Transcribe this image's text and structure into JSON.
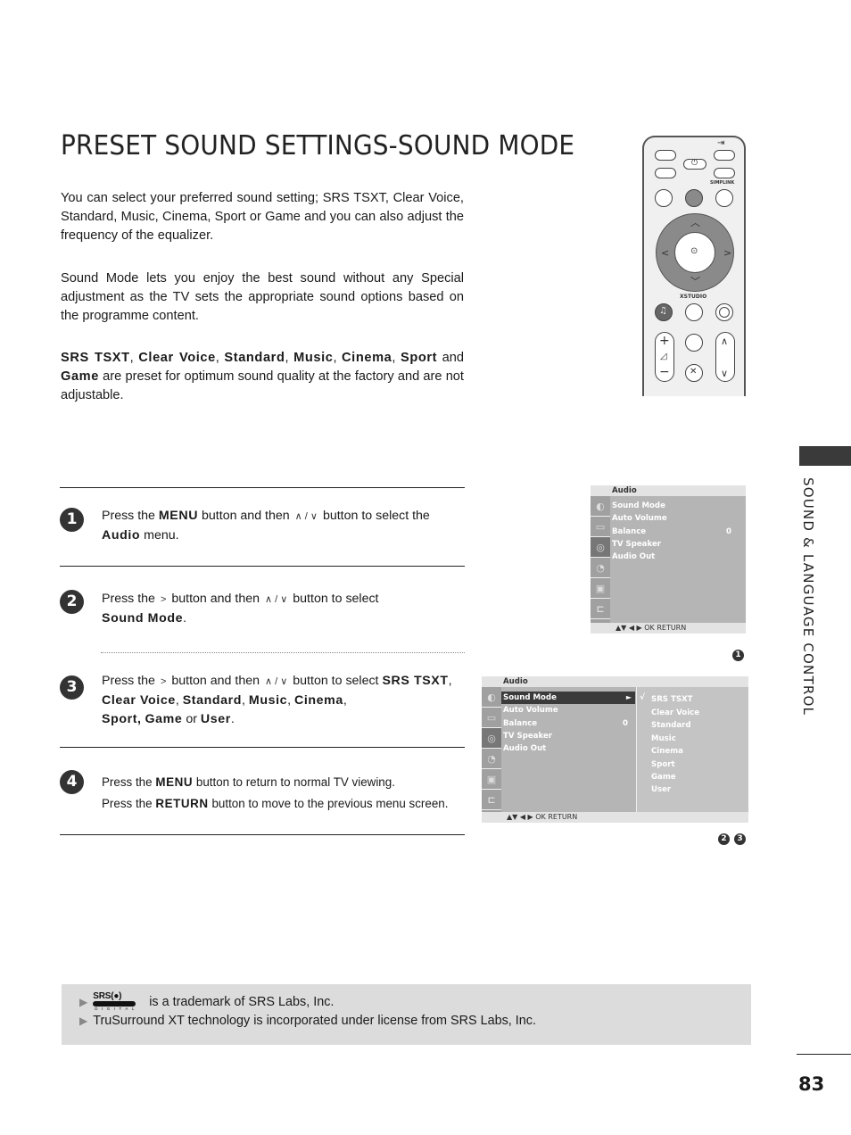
{
  "title": "PRESET SOUND SETTINGS-SOUND MODE",
  "intro": {
    "p1": "You can select your preferred sound setting; SRS TSXT, Clear Voice, Standard, Music, Cinema, Sport or Game and you can also adjust the  frequency of the equalizer.",
    "p2": "Sound Mode lets you enjoy the best sound without any Special adjustment as the TV sets the appropriate sound options based on the programme content.",
    "p3": {
      "bold_items": [
        "SRS TSXT",
        "Clear Voice",
        "Standard",
        "Music",
        "Cinema",
        "Sport"
      ],
      "and_label": "and",
      "game": "Game",
      "rest": "are preset for optimum sound quality at the factory and are not adjustable."
    }
  },
  "remote": {
    "labels": {
      "simplink": "SIMPLINK",
      "xstudio": "XSTUDIO"
    },
    "icons": [
      "input-icon",
      "power-icon",
      "up-arrow-icon",
      "down-arrow-icon",
      "left-arrow-icon",
      "right-arrow-icon",
      "ok-icon",
      "headphone-icon",
      "volume-plus-icon",
      "volume-minus-icon",
      "mute-icon",
      "channel-up-icon",
      "channel-down-icon"
    ]
  },
  "side_tab": {
    "label": "SOUND & LANGUAGE CONTROL"
  },
  "steps": [
    {
      "number": "1",
      "parts": {
        "a": "Press the",
        "menu": "MENU",
        "b": "button and then",
        "c": "button to select the",
        "audio": "Audio",
        "d": "menu."
      }
    },
    {
      "number": "2",
      "parts": {
        "a": "Press the",
        "b": "button and then",
        "c": "button to select",
        "target": "Sound Mode",
        "end": "."
      }
    },
    {
      "number": "3",
      "parts": {
        "a": "Press the",
        "b": "button and then",
        "c": "button to select",
        "options": [
          "SRS TSXT",
          "Clear Voice",
          "Standard",
          "Music",
          "Cinema",
          "Sport",
          "Game"
        ],
        "or": "or",
        "last": "User",
        "end": "."
      }
    },
    {
      "number": "4",
      "line1": {
        "a": "Press the",
        "key": "MENU",
        "b": "button to return to normal TV viewing."
      },
      "line2": {
        "a": "Press the",
        "key": "RETURN",
        "b": "button to move to the previous menu screen."
      }
    }
  ],
  "glyphs": {
    "up_down": "∧ / ∨",
    "right": ">"
  },
  "osd1": {
    "header": "Audio",
    "items": [
      "Sound Mode",
      "Auto Volume",
      "Balance",
      "TV Speaker",
      "Audio Out"
    ],
    "balance_value": "0",
    "footer": "▲▼  ◀ ▶  OK   RETURN",
    "ref": "1"
  },
  "osd2": {
    "header": "Audio",
    "items": [
      "Sound Mode",
      "Auto Volume",
      "Balance",
      "TV Speaker",
      "Audio Out"
    ],
    "selected": "Sound Mode",
    "balance_value": "0",
    "submenu": [
      "SRS TSXT",
      "Clear Voice",
      "Standard",
      "Music",
      "Cinema",
      "Sport",
      "Game",
      "User"
    ],
    "checked": "SRS TSXT",
    "check_mark": "√",
    "footer": "▲▼  ◀ ▶  OK   RETURN",
    "refs": [
      "2",
      "3"
    ]
  },
  "osd_icons": [
    "picture-icon",
    "screen-icon",
    "audio-icon",
    "time-icon",
    "lock-icon",
    "input-icon"
  ],
  "note": {
    "line1": "is a trademark of SRS Labs, Inc.",
    "line2": "TruSurround XT technology is incorporated under license from SRS Labs, Inc.",
    "logo_text": "SRS(●)",
    "logo_sub": "DIGITAL"
  },
  "page_number": "83"
}
